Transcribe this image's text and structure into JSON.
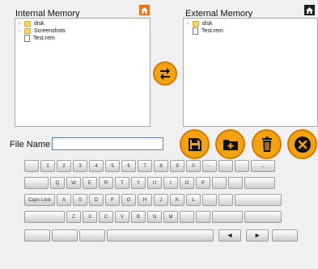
{
  "internal": {
    "title": "Internal Memory",
    "items": [
      {
        "label": "disk",
        "type": "folder",
        "expandable": true
      },
      {
        "label": "Screenshots",
        "type": "folder",
        "expandable": true
      },
      {
        "label": "Test.rem",
        "type": "file",
        "expandable": false
      }
    ]
  },
  "external": {
    "title": "External Memory",
    "items": [
      {
        "label": "disk",
        "type": "folder",
        "expandable": true
      },
      {
        "label": "Test.rem",
        "type": "file",
        "expandable": false
      }
    ]
  },
  "file": {
    "label": "File Name :",
    "value": ""
  },
  "buttons": {
    "transfer": "swap-arrows-icon",
    "save": "floppy-disk-icon",
    "new_folder": "new-folder-icon",
    "delete": "trash-icon",
    "close": "close-icon"
  },
  "keyboard": {
    "row1": [
      {
        "main": ""
      },
      {
        "main": "1"
      },
      {
        "main": "2"
      },
      {
        "main": "3"
      },
      {
        "main": "4"
      },
      {
        "main": "5"
      },
      {
        "main": "6"
      },
      {
        "main": "7"
      },
      {
        "main": "8"
      },
      {
        "main": "9"
      },
      {
        "main": "0"
      },
      {
        "main": "-",
        "shift": "_"
      },
      {
        "main": ""
      },
      {
        "main": ""
      },
      {
        "main": "←"
      }
    ],
    "row2": [
      "",
      "Q",
      "W",
      "E",
      "R",
      "T",
      "Y",
      "U",
      "I",
      "O",
      "P",
      "",
      "",
      ""
    ],
    "row3": [
      "Caps Lock",
      "A",
      "S",
      "D",
      "F",
      "G",
      "H",
      "J",
      "K",
      "L",
      "",
      "",
      ""
    ],
    "row4": [
      "",
      "Z",
      "X",
      "C",
      "V",
      "B",
      "N",
      "M",
      "",
      "",
      "",
      ""
    ],
    "arrows": {
      "left": "◀",
      "right": "▶"
    }
  },
  "colors": {
    "accent": "#f2a313",
    "accent_border": "#d47a00"
  }
}
